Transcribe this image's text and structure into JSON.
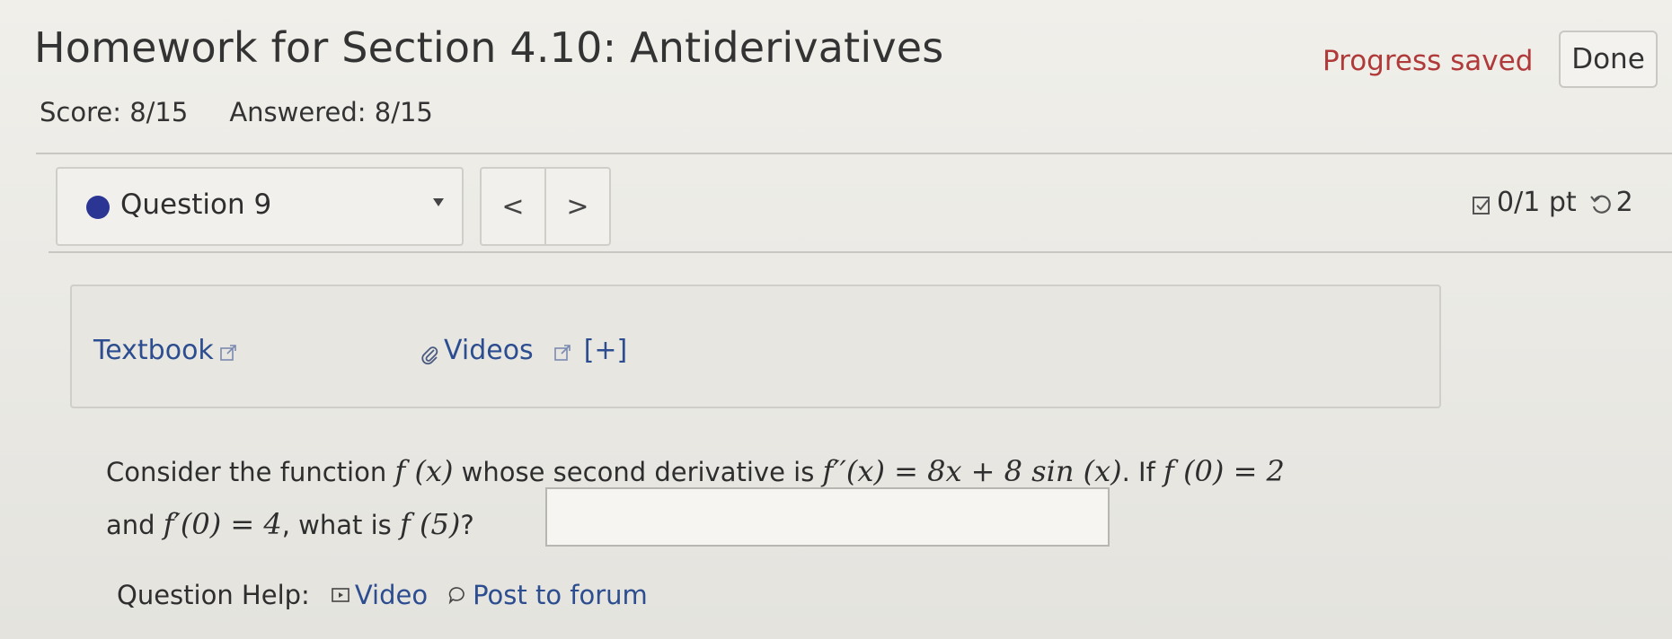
{
  "header": {
    "title": "Homework for Section 4.10: Antiderivatives",
    "progress_status": "Progress saved",
    "done_label": "Done"
  },
  "score": {
    "score_text": "Score: 8/15",
    "answered_text": "Answered: 8/15"
  },
  "question_nav": {
    "selected_question": "Question 9",
    "prev_label": "<",
    "next_label": ">",
    "points": "0/1 pt",
    "attempts": "2"
  },
  "resources": {
    "textbook_label": "Textbook",
    "videos_label": "Videos",
    "expand_label": "[+]"
  },
  "question": {
    "line1_prefix": "Consider the function ",
    "fx": "f (x)",
    "line1_mid": " whose second derivative is ",
    "fpp": "f′′(x) = 8x + 8 sin (x)",
    "line1_if": ". If ",
    "f0": "f (0) = 2",
    "line2_and": "and ",
    "fp0": "f′(0) = 4",
    "line2_what": ", what is ",
    "f5": "f (5)",
    "line2_q": "?",
    "answer_value": ""
  },
  "help": {
    "label": "Question Help:",
    "video_label": "Video",
    "forum_label": "Post to forum"
  },
  "colors": {
    "accent_blue": "#2b3594",
    "link_blue": "#2c4d8f",
    "status_red": "#b03a3a"
  }
}
